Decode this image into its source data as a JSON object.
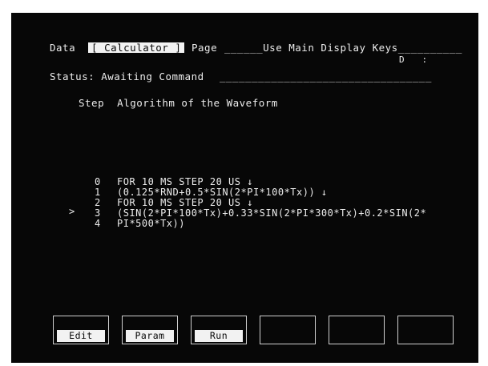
{
  "header": {
    "data_label": "Data",
    "menu_value": "Calculator",
    "page_label": "Page",
    "page_fill": "______Use Main Display Keys__________",
    "right_indicator": "D   :"
  },
  "status": {
    "label": "Status: Awaiting Command",
    "fill": "_________________________________"
  },
  "columns": {
    "step": "Step",
    "algorithm": "Algorithm of the Waveform"
  },
  "program": {
    "cursor": ">",
    "lines": [
      {
        "num": "0",
        "text": "FOR 10 MS STEP 20 US ↓"
      },
      {
        "num": "1",
        "text": "(0.125*RND+0.5*SIN(2*PI*100*Tx)) ↓"
      },
      {
        "num": "2",
        "text": "FOR 10 MS STEP 20 US ↓"
      },
      {
        "num": "3",
        "text": "(SIN(2*PI*100*Tx)+0.33*SIN(2*PI*300*Tx)+0.2*SIN(2*"
      },
      {
        "num": "4",
        "text": "PI*500*Tx))"
      }
    ]
  },
  "softkeys": [
    {
      "label": "Edit"
    },
    {
      "label": "Param"
    },
    {
      "label": "Run"
    },
    {
      "label": ""
    },
    {
      "label": ""
    },
    {
      "label": ""
    }
  ],
  "colors": {
    "screen_bg": "#070707",
    "text": "#ececec",
    "highlight_bg": "#f2f2f2"
  }
}
